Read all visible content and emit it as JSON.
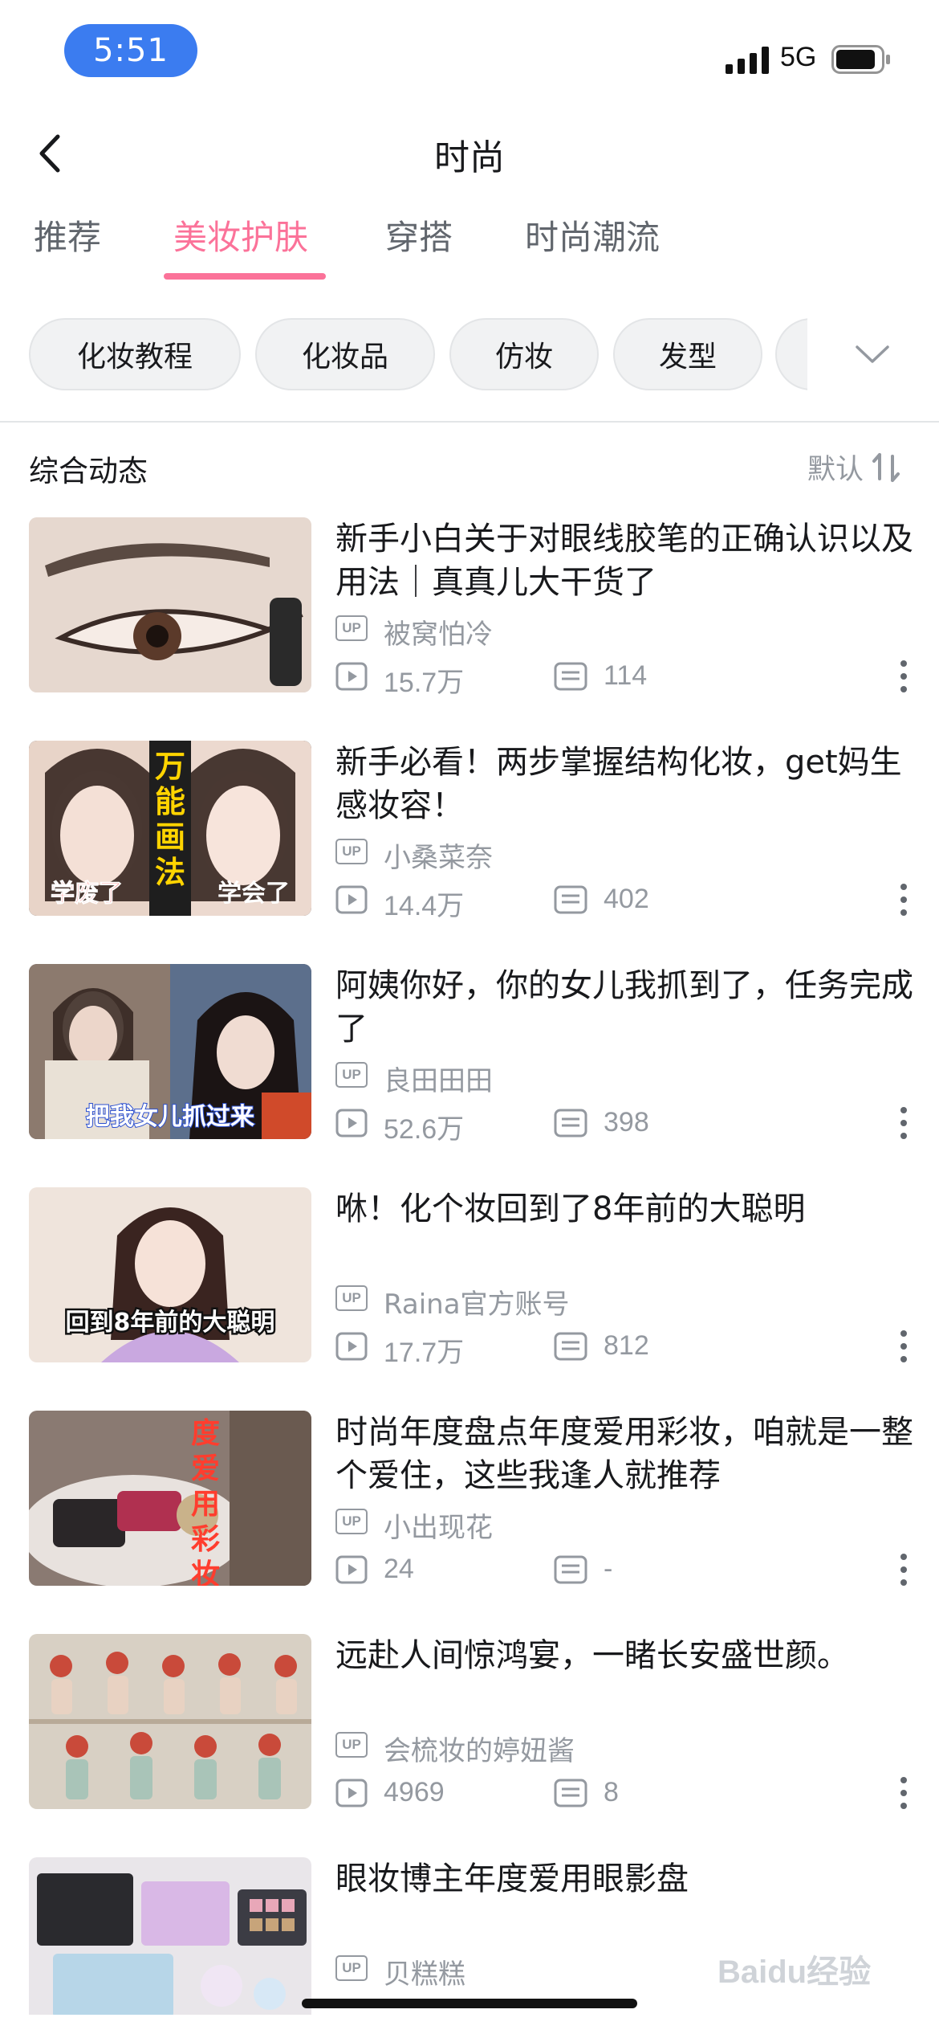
{
  "status_bar": {
    "time": "5:51",
    "network": "5G"
  },
  "nav": {
    "title": "时尚"
  },
  "tabs": [
    {
      "label": "推荐",
      "active": false
    },
    {
      "label": "美妆护肤",
      "active": true
    },
    {
      "label": "穿搭",
      "active": false
    },
    {
      "label": "时尚潮流",
      "active": false
    }
  ],
  "chips": [
    "化妆教程",
    "化妆品",
    "仿妆",
    "发型"
  ],
  "section": {
    "title": "综合动态",
    "sort_label": "默认"
  },
  "items": [
    {
      "title": "新手小白关于对眼线胶笔的正确认识以及用法｜真真儿大干货了",
      "uploader": "被窝怕冷",
      "plays": "15.7万",
      "comments": "114",
      "thumb": {
        "overlay_text": ""
      }
    },
    {
      "title": "新手必看！两步掌握结构化妆，get妈生感妆容！",
      "uploader": "小桑菜奈",
      "plays": "14.4万",
      "comments": "402",
      "thumb": {
        "overlay_text": "万能画法",
        "caption_left": "学废了",
        "caption_right": "学会了"
      }
    },
    {
      "title": "阿姨你好，你的女儿我抓到了，任务完成了",
      "uploader": "良田田田",
      "plays": "52.6万",
      "comments": "398",
      "thumb": {
        "overlay_text": "把我女儿抓过来"
      }
    },
    {
      "title": "咻！化个妆回到了8年前的大聪明",
      "uploader": "Raina官方账号",
      "plays": "17.7万",
      "comments": "812",
      "thumb": {
        "overlay_text": "回到8年前的大聪明"
      }
    },
    {
      "title": "时尚年度盘点年度爱用彩妆，咱就是一整个爱住，这些我逢人就推荐",
      "uploader": "小出现花",
      "plays": "24",
      "comments": "-",
      "thumb": {
        "overlay_text": "度爱用彩妆"
      }
    },
    {
      "title": "远赴人间惊鸿宴，一睹长安盛世颜。",
      "uploader": "会梳妆的婷妞酱",
      "plays": "4969",
      "comments": "8",
      "thumb": {
        "overlay_text": ""
      }
    },
    {
      "title": "眼妆博主年度爱用眼影盘",
      "uploader": "贝糕糕",
      "plays": "",
      "comments": "",
      "thumb": {
        "overlay_text": ""
      }
    }
  ],
  "watermark": "Baidu经验",
  "colors": {
    "accent": "#fb7299",
    "status_pill": "#3b7cf0",
    "secondary_text": "#9499a0"
  },
  "icons": [
    "back-icon",
    "signal-icon",
    "battery-icon",
    "chevron-down-icon",
    "sort-icon",
    "up-badge-icon",
    "play-icon",
    "comment-icon",
    "more-icon"
  ]
}
